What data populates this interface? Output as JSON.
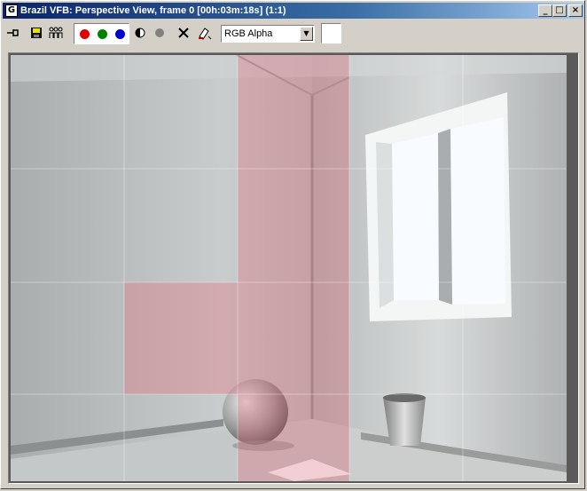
{
  "window": {
    "title": "Brazil VFB: Perspective View, frame 0 [00h:03m:18s] (1:1)",
    "app_icon": "vfb-app-icon",
    "controls": {
      "minimize": "_",
      "maximize": "□",
      "close": "×"
    }
  },
  "toolbar": {
    "tools": [
      {
        "name": "pin-icon",
        "glyph": "⊣"
      },
      {
        "name": "save-icon",
        "glyph": "💾"
      },
      {
        "name": "clone-icon",
        "glyph": "⚇"
      },
      {
        "name": "mono-channel-icon",
        "glyph": "◐"
      },
      {
        "name": "alpha-channel-icon",
        "glyph": "●"
      },
      {
        "name": "clear-icon",
        "glyph": "✕"
      },
      {
        "name": "render-pick-icon",
        "glyph": "✎"
      }
    ],
    "channel_red_color": "#e00000",
    "channel_green_color": "#008000",
    "channel_blue_color": "#0000d0",
    "display_channel": "RGB Alpha",
    "swatch_color": "#ffffff"
  },
  "render": {
    "content": "Rendered interior scene: room corner with window, sphere and bucket; region overlay tiles in red"
  }
}
